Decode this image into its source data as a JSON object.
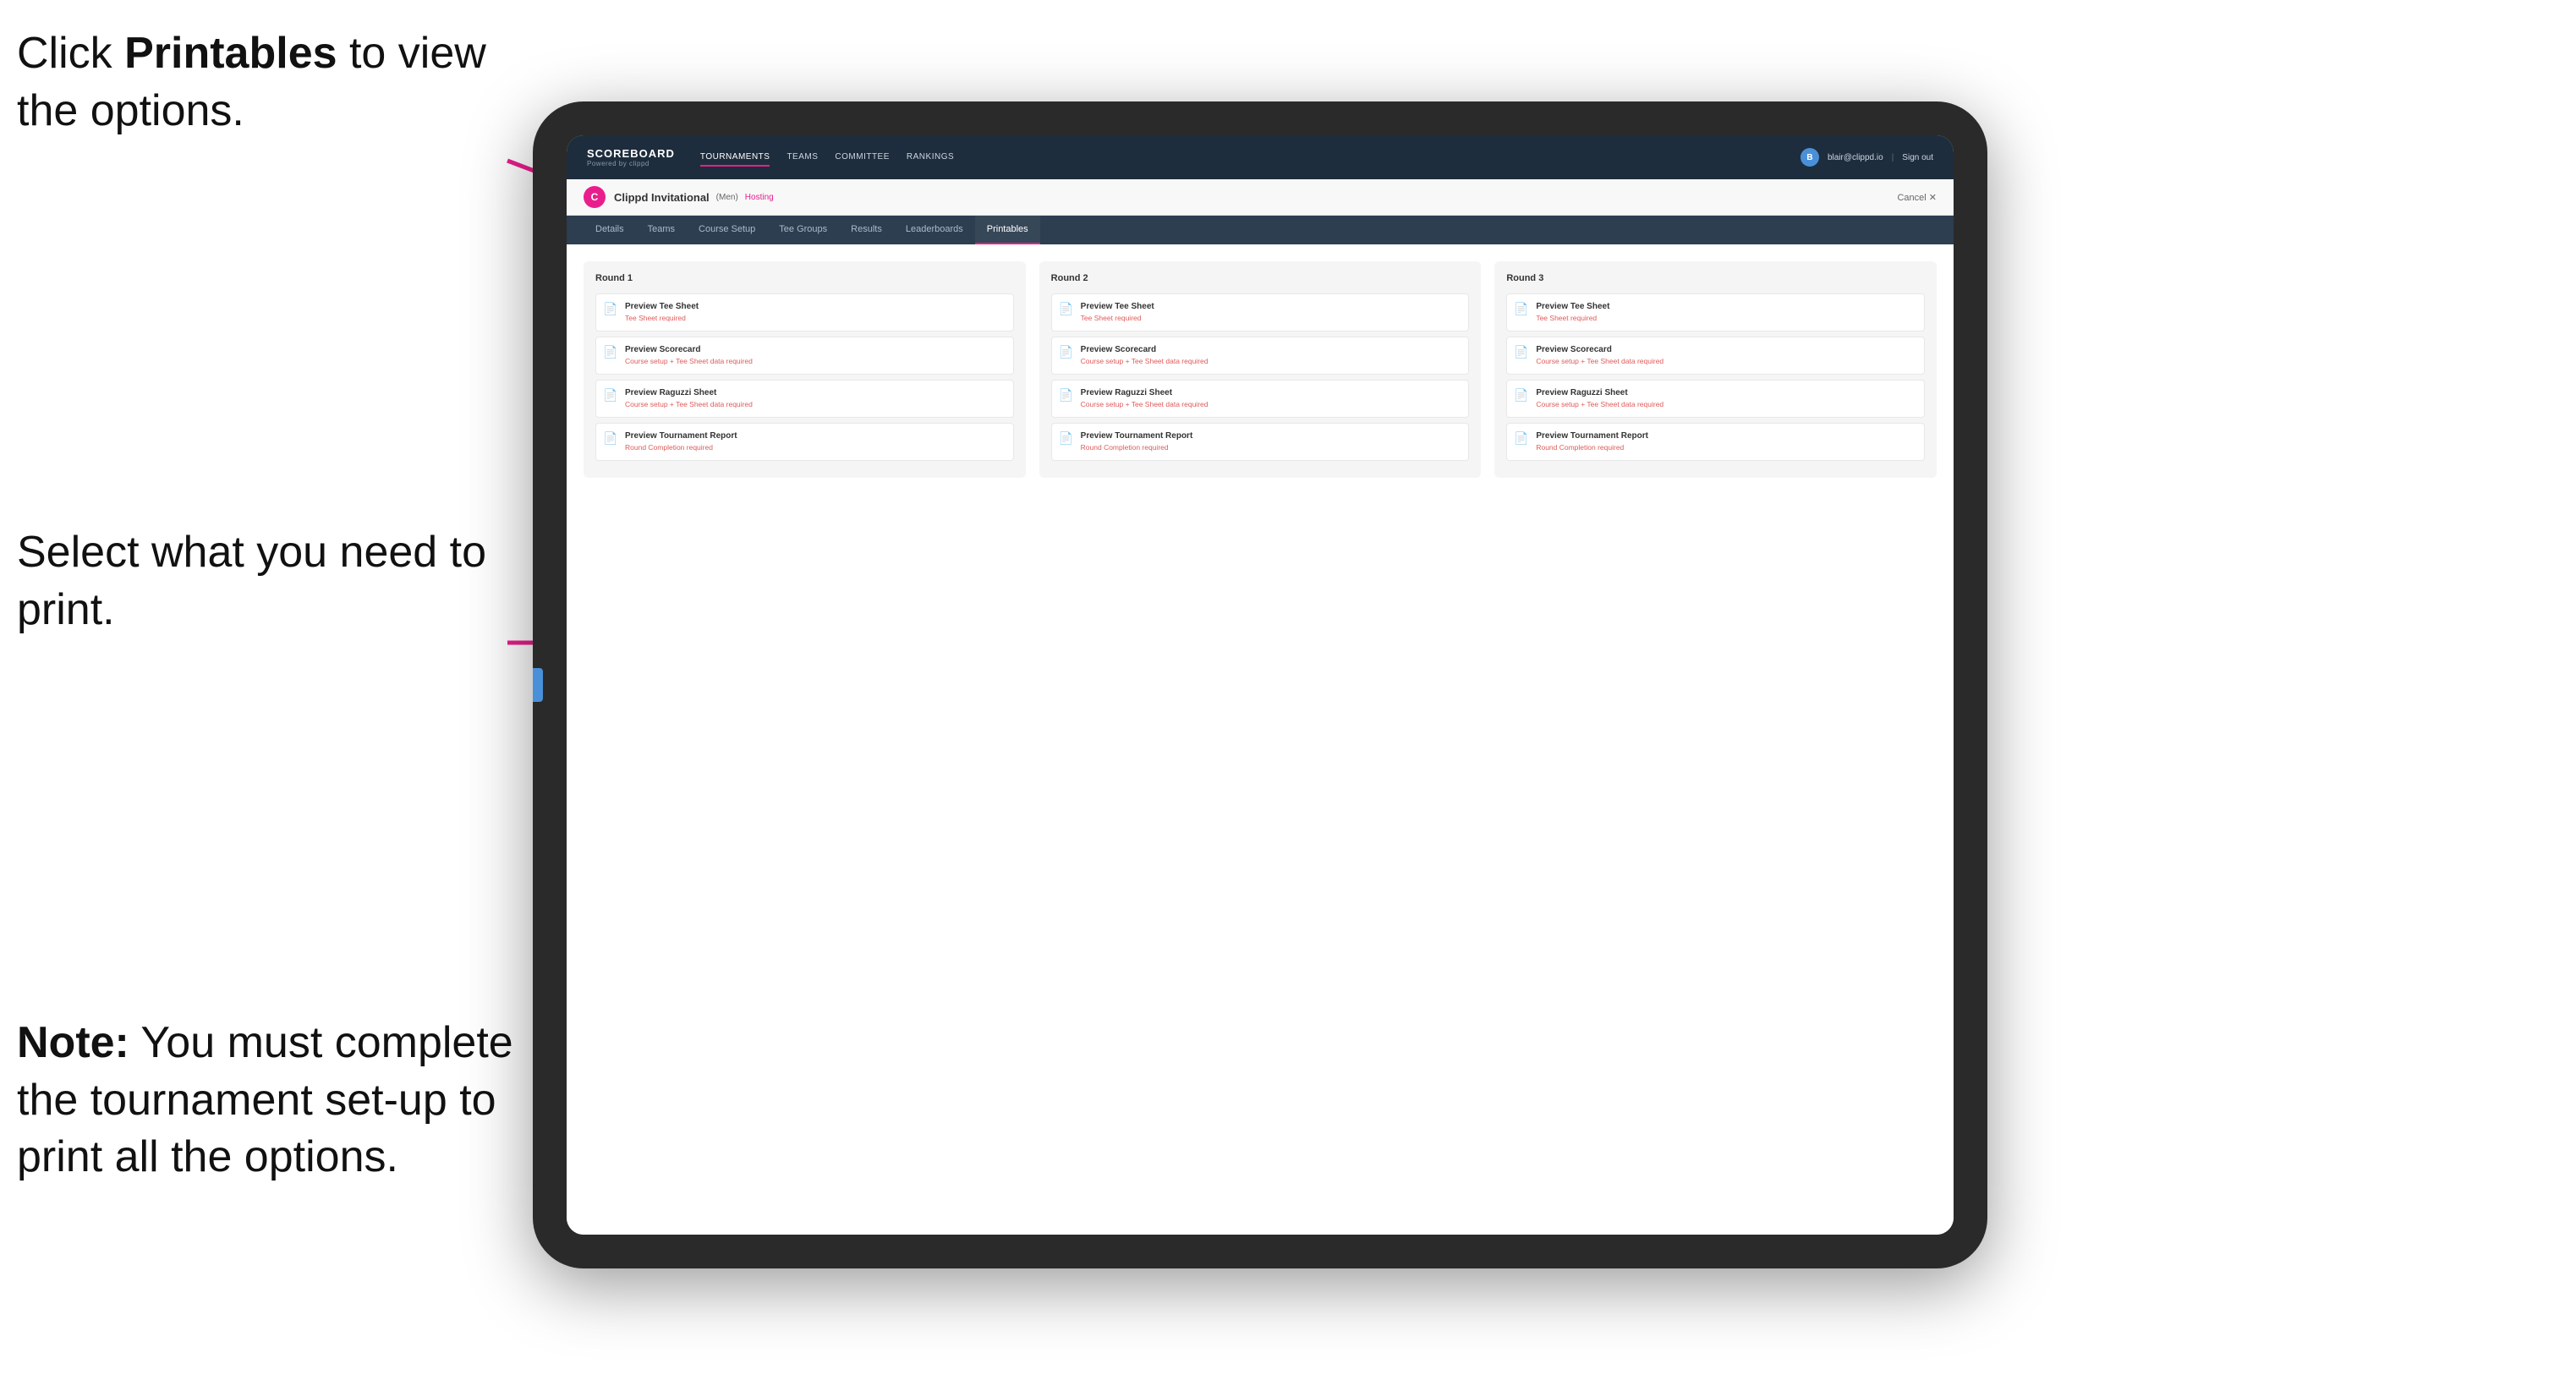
{
  "annotations": {
    "top": {
      "text_before": "Click ",
      "bold": "Printables",
      "text_after": " to view the options."
    },
    "middle": {
      "text": "Select what you need to print."
    },
    "bottom": {
      "text_before": "Note:",
      "bold": " You must complete the tournament set-up to print all the options."
    }
  },
  "top_nav": {
    "logo": "SCOREBOARD",
    "logo_sub": "Powered by clippd",
    "links": [
      "TOURNAMENTS",
      "TEAMS",
      "COMMITTEE",
      "RANKINGS"
    ],
    "active_link": "TOURNAMENTS",
    "user_email": "blair@clippd.io",
    "sign_out": "Sign out"
  },
  "tournament": {
    "name": "Clippd Invitational",
    "tag": "(Men)",
    "status": "Hosting",
    "cancel": "Cancel ✕"
  },
  "tabs": [
    "Details",
    "Teams",
    "Course Setup",
    "Tee Groups",
    "Results",
    "Leaderboards",
    "Printables"
  ],
  "active_tab": "Printables",
  "rounds": [
    {
      "title": "Round 1",
      "items": [
        {
          "title": "Preview Tee Sheet",
          "sub": "Tee Sheet required"
        },
        {
          "title": "Preview Scorecard",
          "sub": "Course setup + Tee Sheet data required"
        },
        {
          "title": "Preview Raguzzi Sheet",
          "sub": "Course setup + Tee Sheet data required"
        },
        {
          "title": "Preview Tournament Report",
          "sub": "Round Completion required"
        }
      ]
    },
    {
      "title": "Round 2",
      "items": [
        {
          "title": "Preview Tee Sheet",
          "sub": "Tee Sheet required"
        },
        {
          "title": "Preview Scorecard",
          "sub": "Course setup + Tee Sheet data required"
        },
        {
          "title": "Preview Raguzzi Sheet",
          "sub": "Course setup + Tee Sheet data required"
        },
        {
          "title": "Preview Tournament Report",
          "sub": "Round Completion required"
        }
      ]
    },
    {
      "title": "Round 3",
      "items": [
        {
          "title": "Preview Tee Sheet",
          "sub": "Tee Sheet required"
        },
        {
          "title": "Preview Scorecard",
          "sub": "Course setup + Tee Sheet data required"
        },
        {
          "title": "Preview Raguzzi Sheet",
          "sub": "Course setup + Tee Sheet data required"
        },
        {
          "title": "Preview Tournament Report",
          "sub": "Round Completion required"
        }
      ]
    }
  ],
  "colors": {
    "nav_bg": "#1e2d3d",
    "accent": "#e91e8c",
    "tab_bg": "#2c3e50"
  }
}
